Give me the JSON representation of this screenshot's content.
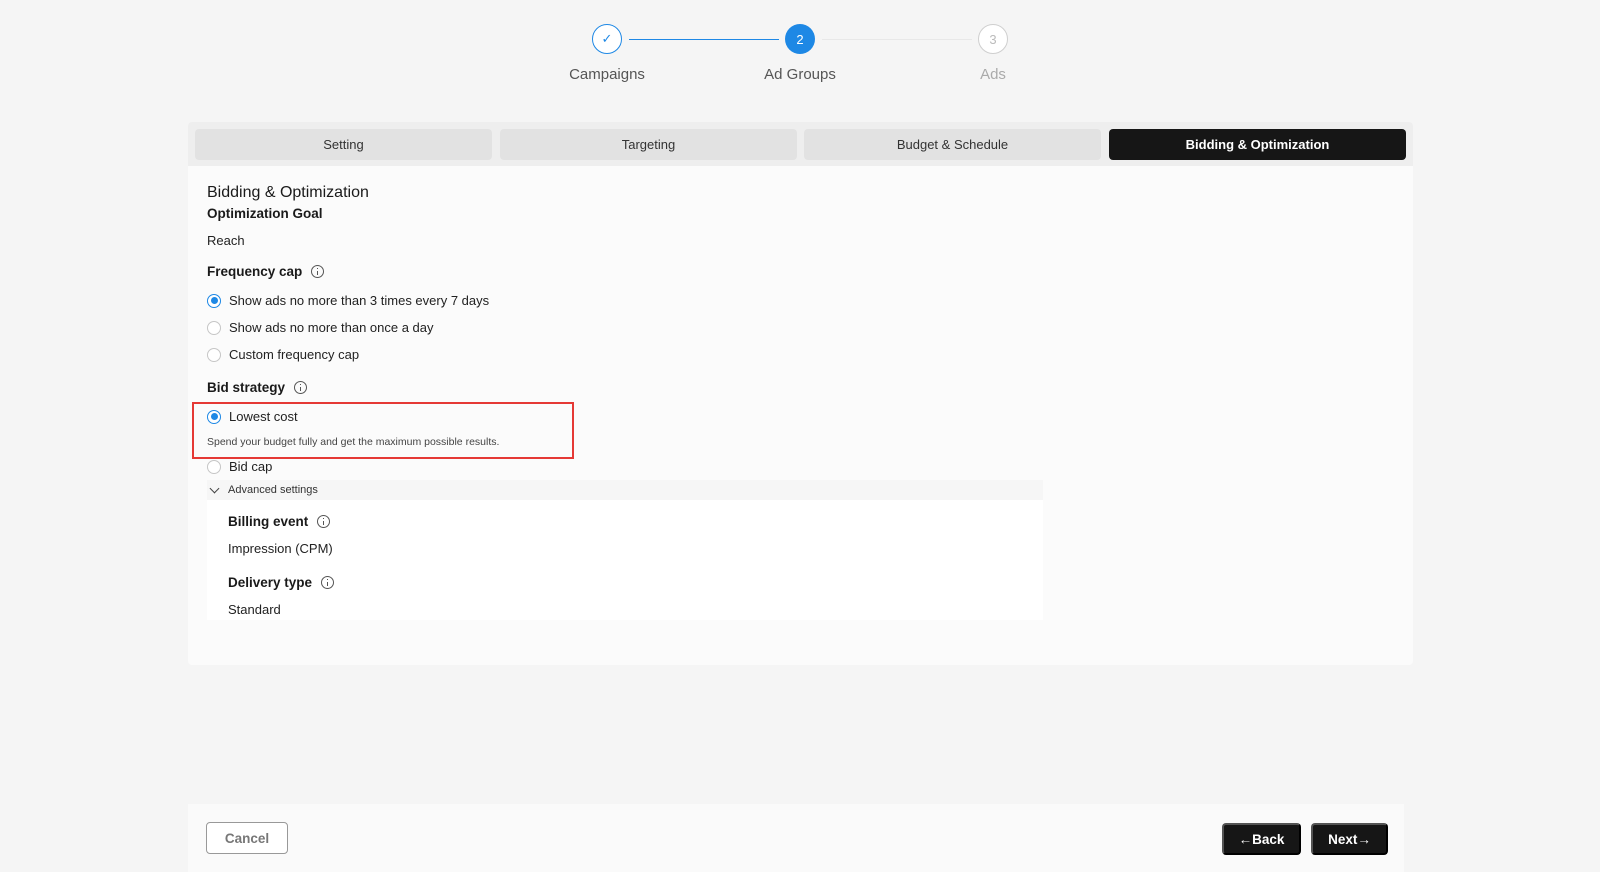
{
  "stepper": {
    "steps": [
      {
        "label": "Campaigns",
        "marker": "✓",
        "state": "done"
      },
      {
        "label": "Ad Groups",
        "marker": "2",
        "state": "active"
      },
      {
        "label": "Ads",
        "marker": "3",
        "state": "pending"
      }
    ]
  },
  "tabs": [
    "Setting",
    "Targeting",
    "Budget & Schedule",
    "Bidding & Optimization"
  ],
  "active_tab": "Bidding & Optimization",
  "section": {
    "title": "Bidding & Optimization",
    "optimization_goal_label": "Optimization Goal",
    "optimization_goal_value": "Reach",
    "frequency_cap_label": "Frequency cap",
    "frequency_options": [
      "Show ads no more than 3 times every 7 days",
      "Show ads no more than once a day",
      "Custom frequency cap"
    ],
    "frequency_selected_index": 0,
    "bid_strategy_label": "Bid strategy",
    "bid_options": [
      "Lowest cost",
      "Bid cap"
    ],
    "bid_selected_index": 0,
    "lowest_cost_desc": "Spend your budget fully and get the maximum possible results.",
    "advanced_label": "Advanced settings",
    "billing_event_label": "Billing event",
    "billing_event_value": "Impression (CPM)",
    "delivery_type_label": "Delivery type",
    "delivery_type_value": "Standard"
  },
  "footer": {
    "cancel": "Cancel",
    "back": "←Back",
    "next": "Next→"
  },
  "colors": {
    "accent": "#1e88e5",
    "highlight": "#e53935",
    "dark_button": "#161616"
  }
}
